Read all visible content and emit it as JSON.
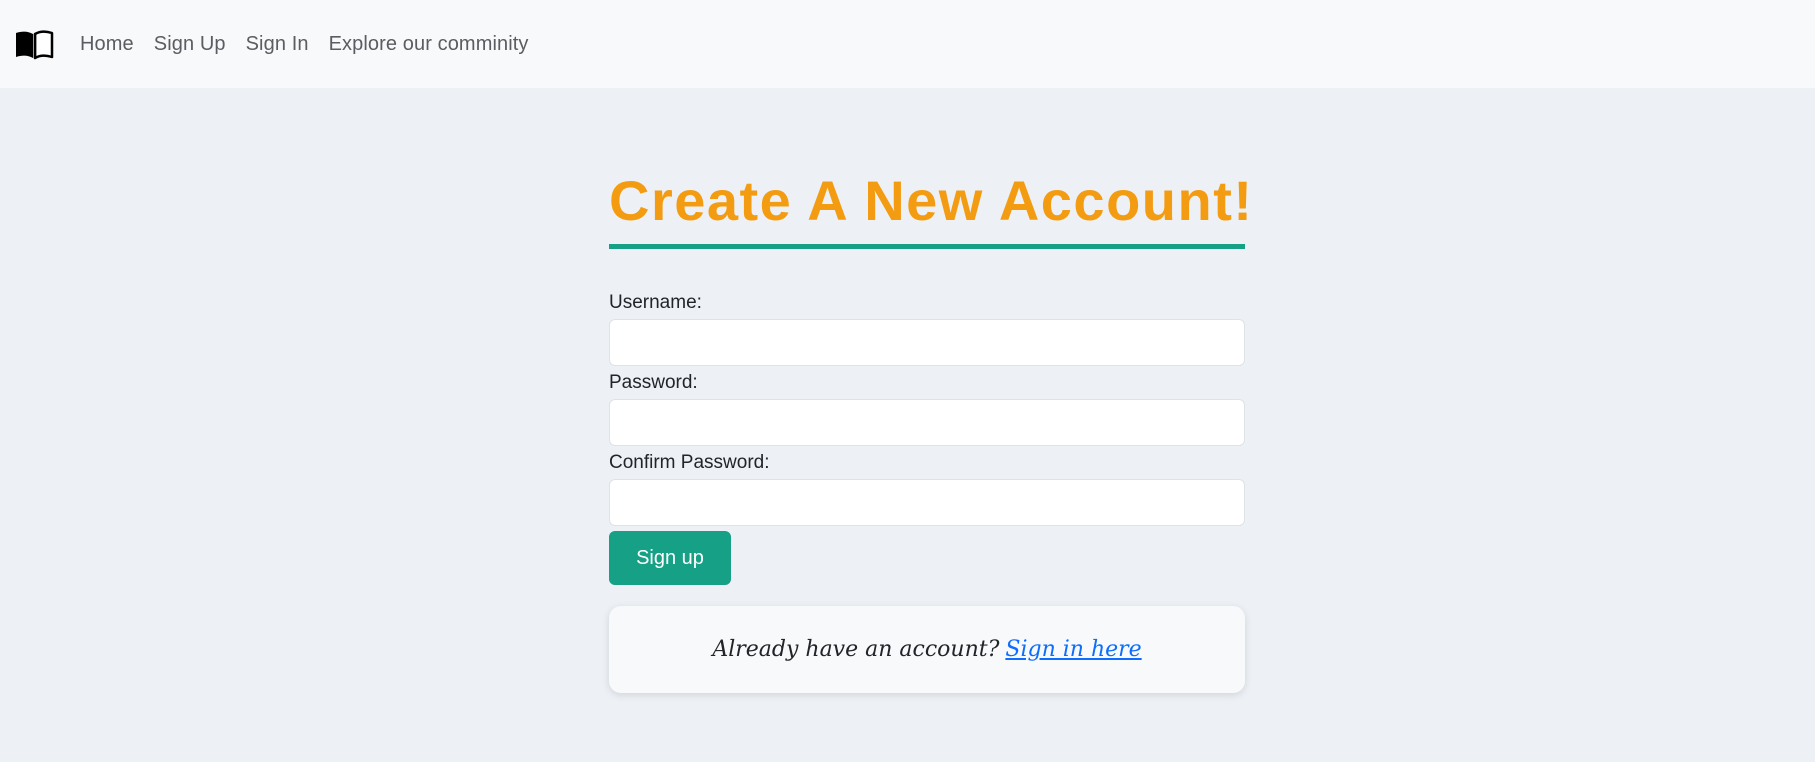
{
  "nav": {
    "brand_icon": "book-icon",
    "links": [
      "Home",
      "Sign Up",
      "Sign In",
      "Explore our comminity"
    ]
  },
  "main": {
    "title": "Create A New Account!",
    "fields": [
      {
        "label": "Username:",
        "value": "",
        "placeholder": ""
      },
      {
        "label": "Password:",
        "value": "",
        "placeholder": ""
      },
      {
        "label": "Confirm Password:",
        "value": "",
        "placeholder": ""
      }
    ],
    "submit_label": "Sign up",
    "signin_prompt": "Already have an account?",
    "signin_link": "Sign in here"
  },
  "colors": {
    "title": "#f39c12",
    "accent": "#16a085",
    "link": "#0d6efd",
    "page_bg": "#edf1f5",
    "navbar_bg": "#f8f9fa"
  }
}
